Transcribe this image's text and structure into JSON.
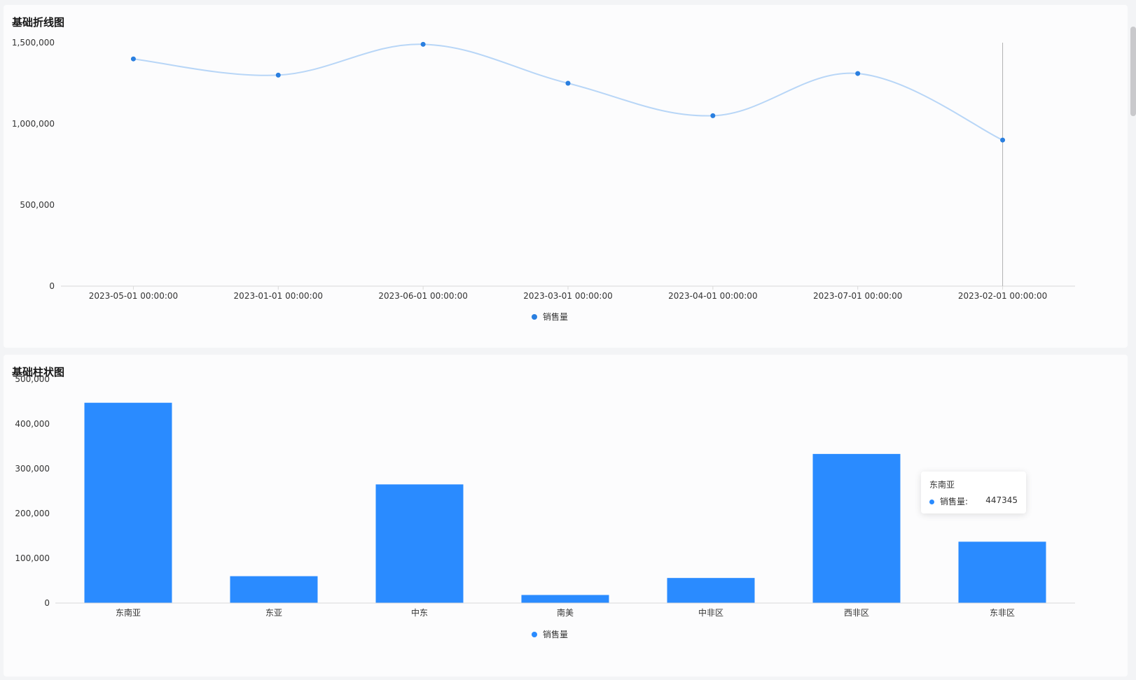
{
  "colors": {
    "line": "#b8d6f7",
    "point": "#2a7fe0",
    "bar": "#2a8bff",
    "axis": "#d9d9d9",
    "crosshair": "#b0b0b0",
    "text": "#333333"
  },
  "chart_data": [
    {
      "type": "line",
      "title": "基础折线图",
      "x": [
        "2023-05-01 00:00:00",
        "2023-01-01 00:00:00",
        "2023-06-01 00:00:00",
        "2023-03-01 00:00:00",
        "2023-04-01 00:00:00",
        "2023-07-01 00:00:00",
        "2023-02-01 00:00:00"
      ],
      "series": [
        {
          "name": "销售量",
          "values": [
            1400000,
            1300000,
            1490000,
            1250000,
            1050000,
            1310000,
            900000
          ]
        }
      ],
      "ylim": [
        0,
        1500000
      ],
      "y_ticks": [
        "0",
        "500,000",
        "1,000,000",
        "1,500,000"
      ],
      "smooth": true,
      "legend": "bottom-center",
      "crosshair_index": 6
    },
    {
      "type": "bar",
      "title": "基础柱状图",
      "categories": [
        "东南亚",
        "东亚",
        "中东",
        "南美",
        "中非区",
        "西非区",
        "东非区"
      ],
      "series": [
        {
          "name": "销售量",
          "values": [
            447345,
            60000,
            265000,
            18000,
            56000,
            333000,
            137000
          ]
        }
      ],
      "ylim": [
        0,
        500000
      ],
      "y_ticks": [
        "0",
        "100,000",
        "200,000",
        "300,000",
        "400,000",
        "500,000"
      ],
      "legend": "bottom-center"
    }
  ],
  "tooltip": {
    "title": "东南亚",
    "series_name": "销售量:",
    "value": "447345"
  }
}
